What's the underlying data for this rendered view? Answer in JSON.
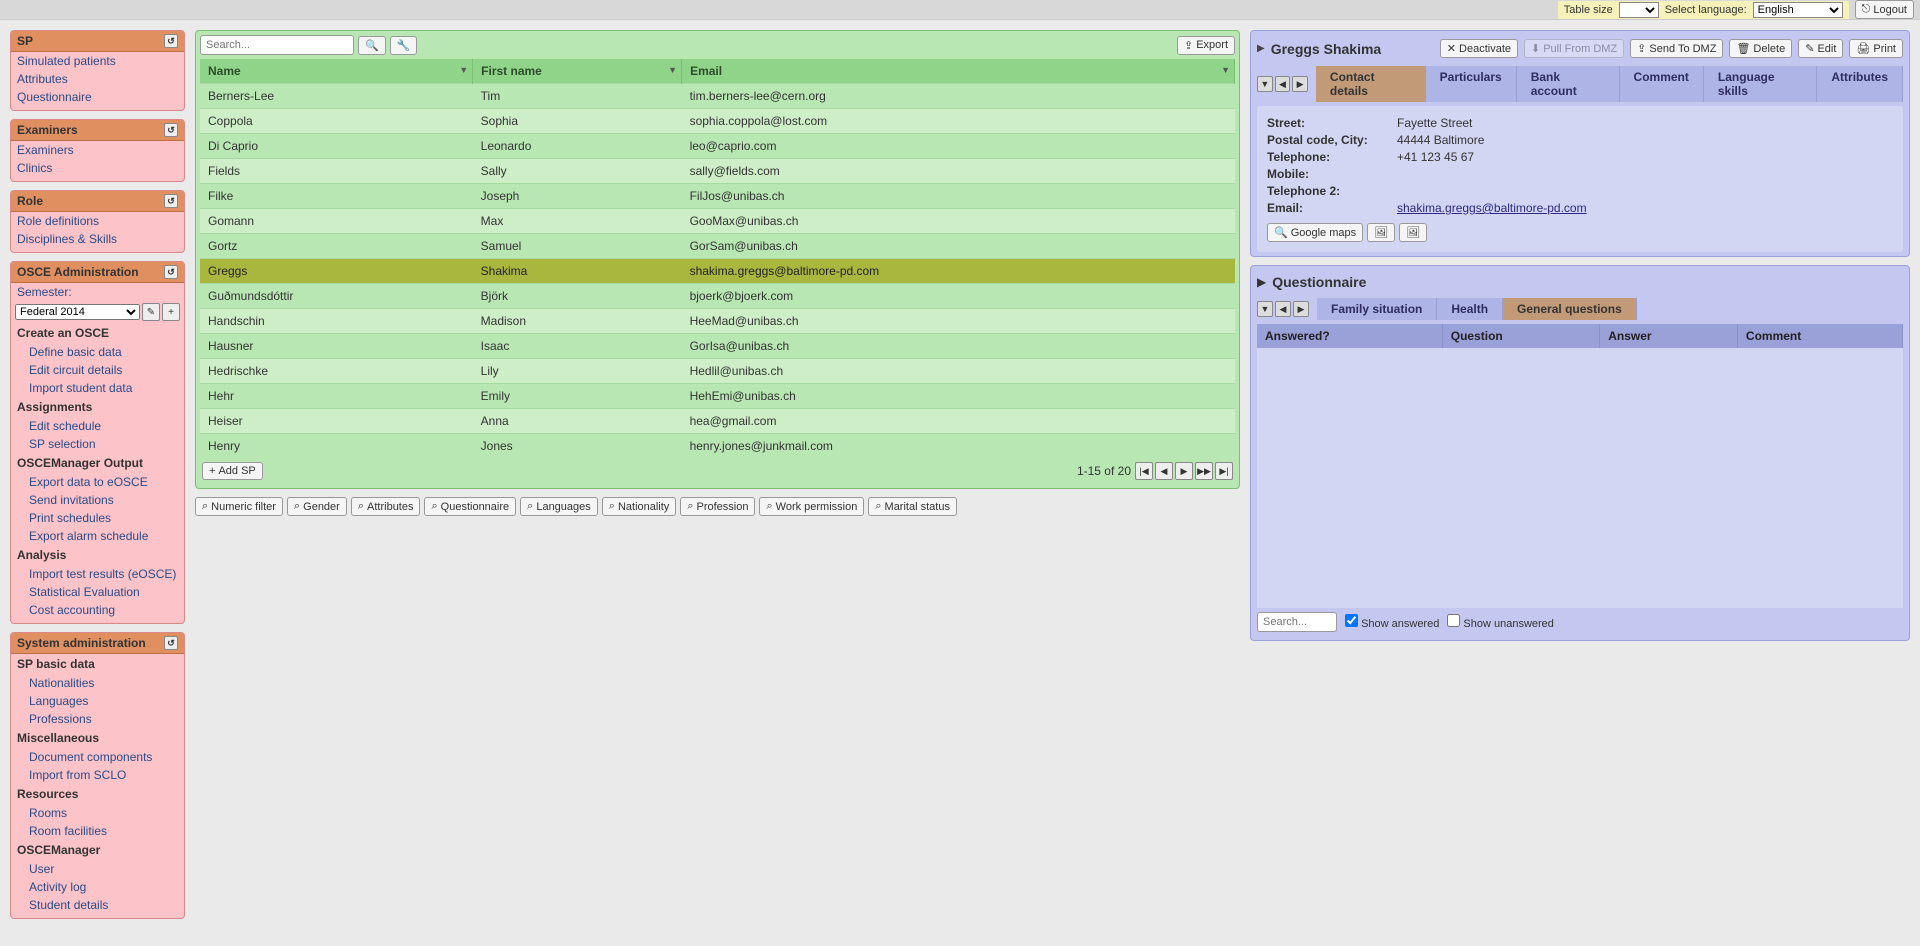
{
  "topbar": {
    "table_size_label": "Table size",
    "select_language_label": "Select language:",
    "language_value": "English",
    "logout_label": "Logout"
  },
  "sidebar": {
    "sp": {
      "title": "SP",
      "items": [
        "Simulated patients",
        "Attributes",
        "Questionnaire"
      ]
    },
    "examiners": {
      "title": "Examiners",
      "items": [
        "Examiners",
        "Clinics"
      ]
    },
    "role": {
      "title": "Role",
      "items": [
        "Role definitions",
        "Disciplines & Skills"
      ]
    },
    "osce": {
      "title": "OSCE Administration",
      "semester_label": "Semester:",
      "semester_value": "Federal 2014",
      "groups": [
        {
          "head": "Create an OSCE",
          "items": [
            "Define basic data",
            "Edit circuit details",
            "Import student data"
          ]
        },
        {
          "head": "Assignments",
          "items": [
            "Edit schedule",
            "SP selection"
          ]
        },
        {
          "head": "OSCEManager Output",
          "items": [
            "Export data to eOSCE",
            "Send invitations",
            "Print schedules",
            "Export alarm schedule"
          ]
        },
        {
          "head": "Analysis",
          "items": [
            "Import test results (eOSCE)",
            "Statistical Evaluation",
            "Cost accounting"
          ]
        }
      ]
    },
    "sysadmin": {
      "title": "System administration",
      "groups": [
        {
          "head": "SP basic data",
          "items": [
            "Nationalities",
            "Languages",
            "Professions"
          ]
        },
        {
          "head": "Miscellaneous",
          "items": [
            "Document components",
            "Import from SCLO"
          ]
        },
        {
          "head": "Resources",
          "items": [
            "Rooms",
            "Room facilities"
          ]
        },
        {
          "head": "OSCEManager",
          "items": [
            "User",
            "Activity log",
            "Student details"
          ]
        }
      ]
    }
  },
  "list": {
    "search_placeholder": "Search...",
    "export_label": "Export",
    "columns": [
      "Name",
      "First name",
      "Email"
    ],
    "rows": [
      {
        "name": "Berners-Lee",
        "first": "Tim",
        "email": "tim.berners-lee@cern.org"
      },
      {
        "name": "Coppola",
        "first": "Sophia",
        "email": "sophia.coppola@lost.com"
      },
      {
        "name": "Di Caprio",
        "first": "Leonardo",
        "email": "leo@caprio.com"
      },
      {
        "name": "Fields",
        "first": "Sally",
        "email": "sally@fields.com"
      },
      {
        "name": "Filke",
        "first": "Joseph",
        "email": "FilJos@unibas.ch"
      },
      {
        "name": "Gomann",
        "first": "Max",
        "email": "GooMax@unibas.ch"
      },
      {
        "name": "Gortz",
        "first": "Samuel",
        "email": "GorSam@unibas.ch"
      },
      {
        "name": "Greggs",
        "first": "Shakima",
        "email": "shakima.greggs@baltimore-pd.com",
        "selected": true
      },
      {
        "name": "Guðmundsdóttir",
        "first": "Björk",
        "email": "bjoerk@bjoerk.com"
      },
      {
        "name": "Handschin",
        "first": "Madison",
        "email": "HeeMad@unibas.ch"
      },
      {
        "name": "Hausner",
        "first": "Isaac",
        "email": "GorIsa@unibas.ch"
      },
      {
        "name": "Hedrischke",
        "first": "Lily",
        "email": "Hedlil@unibas.ch"
      },
      {
        "name": "Hehr",
        "first": "Emily",
        "email": "HehEmi@unibas.ch"
      },
      {
        "name": "Heiser",
        "first": "Anna",
        "email": "hea@gmail.com"
      },
      {
        "name": "Henry",
        "first": "Jones",
        "email": "henry.jones@junkmail.com"
      }
    ],
    "add_sp_label": "Add SP",
    "pager_text": "1-15 of 20",
    "filters": [
      "Numeric filter",
      "Gender",
      "Attributes",
      "Questionnaire",
      "Languages",
      "Nationality",
      "Profession",
      "Work permission",
      "Marital status"
    ]
  },
  "detail": {
    "title": "Greggs Shakima",
    "actions": {
      "deactivate": "Deactivate",
      "pull_from_dmz": "Pull From DMZ",
      "send_to_dmz": "Send To DMZ",
      "delete": "Delete",
      "edit": "Edit",
      "print": "Print"
    },
    "tabs": [
      "Contact details",
      "Particulars",
      "Bank account",
      "Comment",
      "Language skills",
      "Attributes"
    ],
    "active_tab": 0,
    "contact": {
      "street_label": "Street:",
      "street": "Fayette Street",
      "postal_label": "Postal code, City:",
      "postal": "44444 Baltimore",
      "telephone_label": "Telephone:",
      "telephone": "+41 123 45 67",
      "mobile_label": "Mobile:",
      "mobile": "",
      "telephone2_label": "Telephone 2:",
      "telephone2": "",
      "email_label": "Email:",
      "email": "shakima.greggs@baltimore-pd.com",
      "google_maps_label": "Google maps"
    }
  },
  "questionnaire": {
    "title": "Questionnaire",
    "tabs": [
      "Family situation",
      "Health",
      "General questions"
    ],
    "active_tab": 2,
    "columns": [
      "Answered?",
      "Question",
      "Answer",
      "Comment"
    ],
    "search_placeholder": "Search...",
    "show_answered_label": "Show answered",
    "show_unanswered_label": "Show unanswered",
    "show_answered": true,
    "show_unanswered": false
  }
}
